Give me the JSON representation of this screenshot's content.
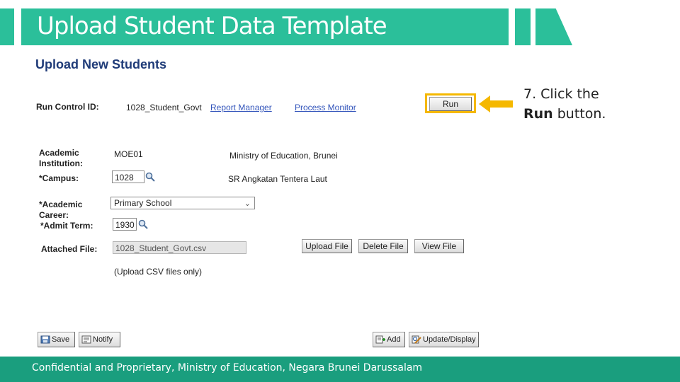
{
  "slide": {
    "title": "Upload Student Data Template",
    "footer": "Confidential and Proprietary, Ministry of Education, Negara Brunei Darussalam",
    "instruction": {
      "step": "7. Click the",
      "bold": "Run",
      "rest": "button."
    }
  },
  "page": {
    "heading": "Upload New Students",
    "run_control": {
      "label": "Run Control ID:",
      "value": "1028_Student_Govt",
      "report_manager": "Report Manager",
      "process_monitor": "Process Monitor",
      "run_label": "Run"
    },
    "academic_institution": {
      "label_line1": "Academic",
      "label_line2": "Institution:",
      "code": "MOE01",
      "description": "Ministry of Education, Brunei"
    },
    "campus": {
      "label": "*Campus:",
      "value": "1028",
      "description": "SR Angkatan Tentera Laut"
    },
    "academic_career": {
      "label_line1": "*Academic",
      "label_line2": "Career:",
      "selected": "Primary School"
    },
    "admit_term": {
      "label": "*Admit Term:",
      "value": "1930"
    },
    "attached_file": {
      "label": "Attached File:",
      "value": "1028_Student_Govt.csv",
      "upload_label": "Upload File",
      "delete_label": "Delete File",
      "view_label": "View File",
      "hint": "(Upload CSV files only)"
    },
    "toolbar": {
      "save": "Save",
      "notify": "Notify",
      "add": "Add",
      "update_display": "Update/Display"
    }
  },
  "colors": {
    "banner": "#2bbf9a",
    "footer": "#1a9e7e",
    "highlight": "#f5b800",
    "link": "#3355bb",
    "heading": "#1f3b78"
  }
}
